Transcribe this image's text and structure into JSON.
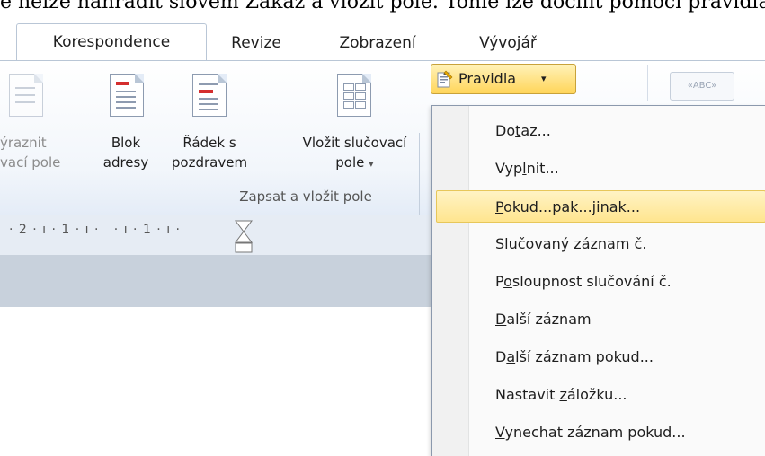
{
  "document": {
    "top_line": "e nelze nahradit slovem Zákaz a vložit pole. Tohle lze docílit pomocí pravidla"
  },
  "tabs": [
    {
      "label": "Korespondence",
      "selected": true
    },
    {
      "label": "Revize"
    },
    {
      "label": "Zobrazení"
    },
    {
      "label": "Vývojář"
    }
  ],
  "ribbon": {
    "commands": {
      "zvyraznit": {
        "line1": "ýraznit",
        "line2": "vací pole"
      },
      "blok_adresy": {
        "line1": "Blok",
        "line2": "adresy"
      },
      "radek_s_pozdravem": {
        "line1": "Řádek s",
        "line2": "pozdravem"
      },
      "vlozit_slucovaci_pole": {
        "line1": "Vložit slučovací",
        "line2": "pole",
        "caret": "▾"
      }
    },
    "group_label": "Zapsat a vložit pole",
    "pravidla": {
      "label": "Pravidla",
      "caret": "▾"
    },
    "abc_label": "«ABC»"
  },
  "ruler": {
    "numbers": "· 2 · ı · 1 · ı ·   · ı · 1 · ı ·"
  },
  "menu": {
    "items": [
      {
        "pre": "Do",
        "key": "t",
        "post": "az...",
        "active": false
      },
      {
        "pre": "Vyp",
        "key": "l",
        "post": "nit...",
        "active": false
      },
      {
        "pre": "",
        "key": "P",
        "post": "okud...pak...jinak...",
        "active": true
      },
      {
        "pre": "",
        "key": "S",
        "post": "lučovaný záznam č.",
        "active": false
      },
      {
        "pre": "P",
        "key": "o",
        "post": "sloupnost slučování č.",
        "active": false
      },
      {
        "pre": "",
        "key": "D",
        "post": "alší záznam",
        "active": false
      },
      {
        "pre": "D",
        "key": "a",
        "post": "lší záznam pokud...",
        "active": false
      },
      {
        "pre": "Nastavit ",
        "key": "z",
        "post": "áložku...",
        "active": false
      },
      {
        "pre": "",
        "key": "V",
        "post": "ynechat záznam pokud...",
        "active": false
      }
    ]
  },
  "colors": {
    "highlight": "#ffe58f",
    "ribbon_bg": "#f2f6fb",
    "red_accent": "#d42e2e"
  }
}
